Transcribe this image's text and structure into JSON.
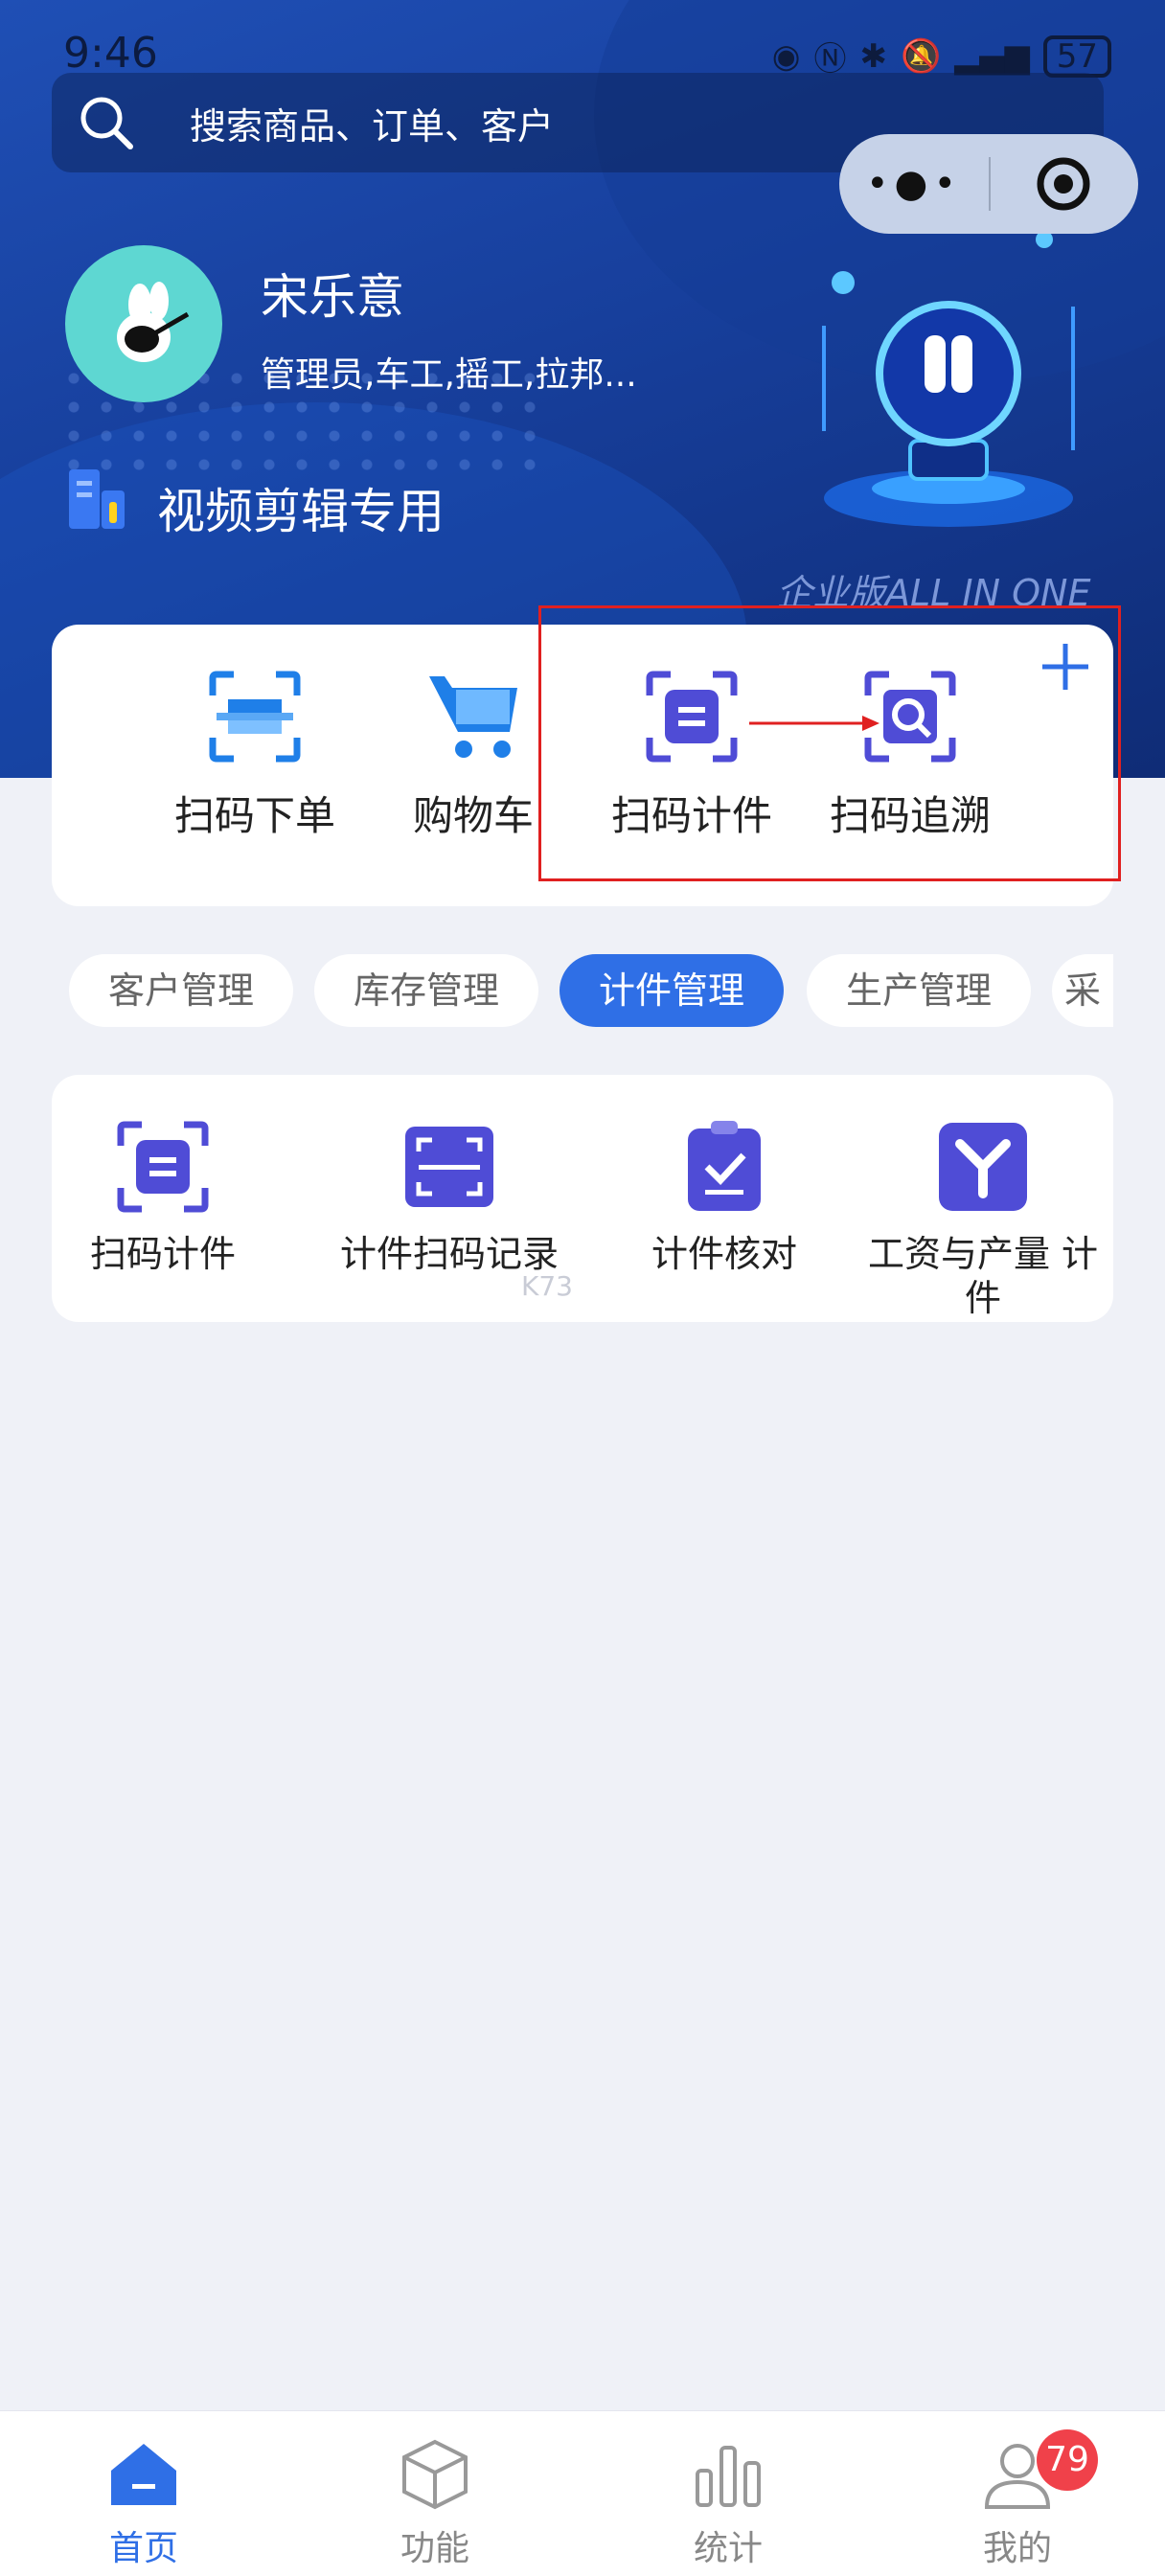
{
  "status_bar": {
    "time": "9:46",
    "battery": "57"
  },
  "search": {
    "placeholder": "搜索商品、订单、客户"
  },
  "profile": {
    "name": "宋乐意",
    "roles": "管理员,车工,摇工,拉邦...",
    "company": "视频剪辑专用",
    "edition": "企业版ALL IN ONE"
  },
  "quick_actions": [
    {
      "label": "扫码下单",
      "icon": "scan-order-icon"
    },
    {
      "label": "购物车",
      "icon": "cart-icon"
    },
    {
      "label": "扫码计件",
      "icon": "scan-piece-icon"
    },
    {
      "label": "扫码追溯",
      "icon": "scan-trace-icon"
    }
  ],
  "tabs": [
    {
      "label": "客户管理"
    },
    {
      "label": "库存管理"
    },
    {
      "label": "计件管理",
      "active": true
    },
    {
      "label": "生产管理"
    },
    {
      "label": "采"
    }
  ],
  "functions": [
    {
      "label": "扫码计件",
      "icon": "scan-piece-icon"
    },
    {
      "label": "计件扫码记录",
      "icon": "scan-record-icon"
    },
    {
      "label": "计件核对",
      "icon": "clipboard-check-icon"
    },
    {
      "label": "工资与产量 计件",
      "icon": "y-shape-icon"
    }
  ],
  "watermark": "K73",
  "bottom_nav": [
    {
      "label": "首页",
      "icon": "home-icon",
      "active": true
    },
    {
      "label": "功能",
      "icon": "cube-icon"
    },
    {
      "label": "统计",
      "icon": "bar-chart-icon"
    },
    {
      "label": "我的",
      "icon": "user-icon"
    }
  ],
  "badge": "79",
  "colors": {
    "primary": "#2f6fe6",
    "header": "#173f9c",
    "icon_purple": "#4f4cd6",
    "highlight": "#e02020"
  }
}
